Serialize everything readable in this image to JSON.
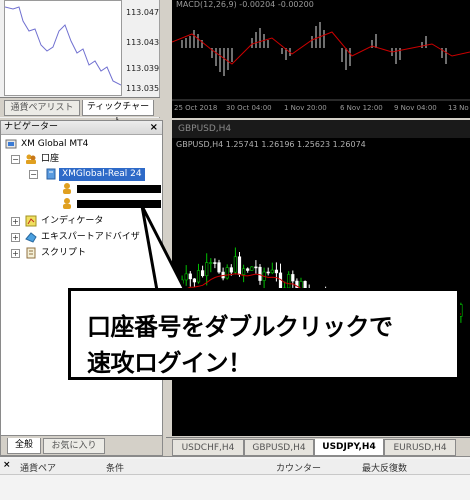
{
  "tick_panel": {
    "price_labels": [
      "113.047",
      "113.043",
      "113.039",
      "113.035"
    ],
    "tabs": [
      "通貨ペアリスト",
      "ティックチャート"
    ]
  },
  "chart_top": {
    "indicator_label": "MACD(12,26,9) -0.00204 -0.00200",
    "time_labels": [
      "25 Oct 2018",
      "30 Oct 04:00",
      "1 Nov 20:00",
      "6 Nov 12:00",
      "9 Nov 04:00",
      "13 No"
    ]
  },
  "chart_main": {
    "window_title": "GBPUSD,H4",
    "info_line": "GBPUSD,H4  1.25741 1.26196 1.25623 1.26074"
  },
  "chart_tabs": [
    "USDCHF,H4",
    "GBPUSD,H4",
    "USDJPY,H4",
    "EURUSD,H4"
  ],
  "navigator": {
    "title": "ナビゲーター",
    "close": "×",
    "tree": {
      "root": "XM Global MT4",
      "accounts_folder": "口座",
      "account_server": "XMGlobal-Real 24",
      "indicators": "インディケータ",
      "experts": "エキスパートアドバイザ",
      "scripts": "スクリプト"
    },
    "tabs": [
      "全般",
      "お気に入り"
    ]
  },
  "terminal": {
    "close": "×",
    "columns": [
      "通貨ペア",
      "条件",
      "カウンター",
      "最大反復数"
    ]
  },
  "callout": {
    "line1": "口座番号をダブルクリックで",
    "line2": "速攻ログイン！"
  },
  "colors": {
    "selection": "#2e6ac8",
    "bull_candle": "#00c000",
    "bear_candle": "#ffffff",
    "ma_line": "#cc0000"
  }
}
